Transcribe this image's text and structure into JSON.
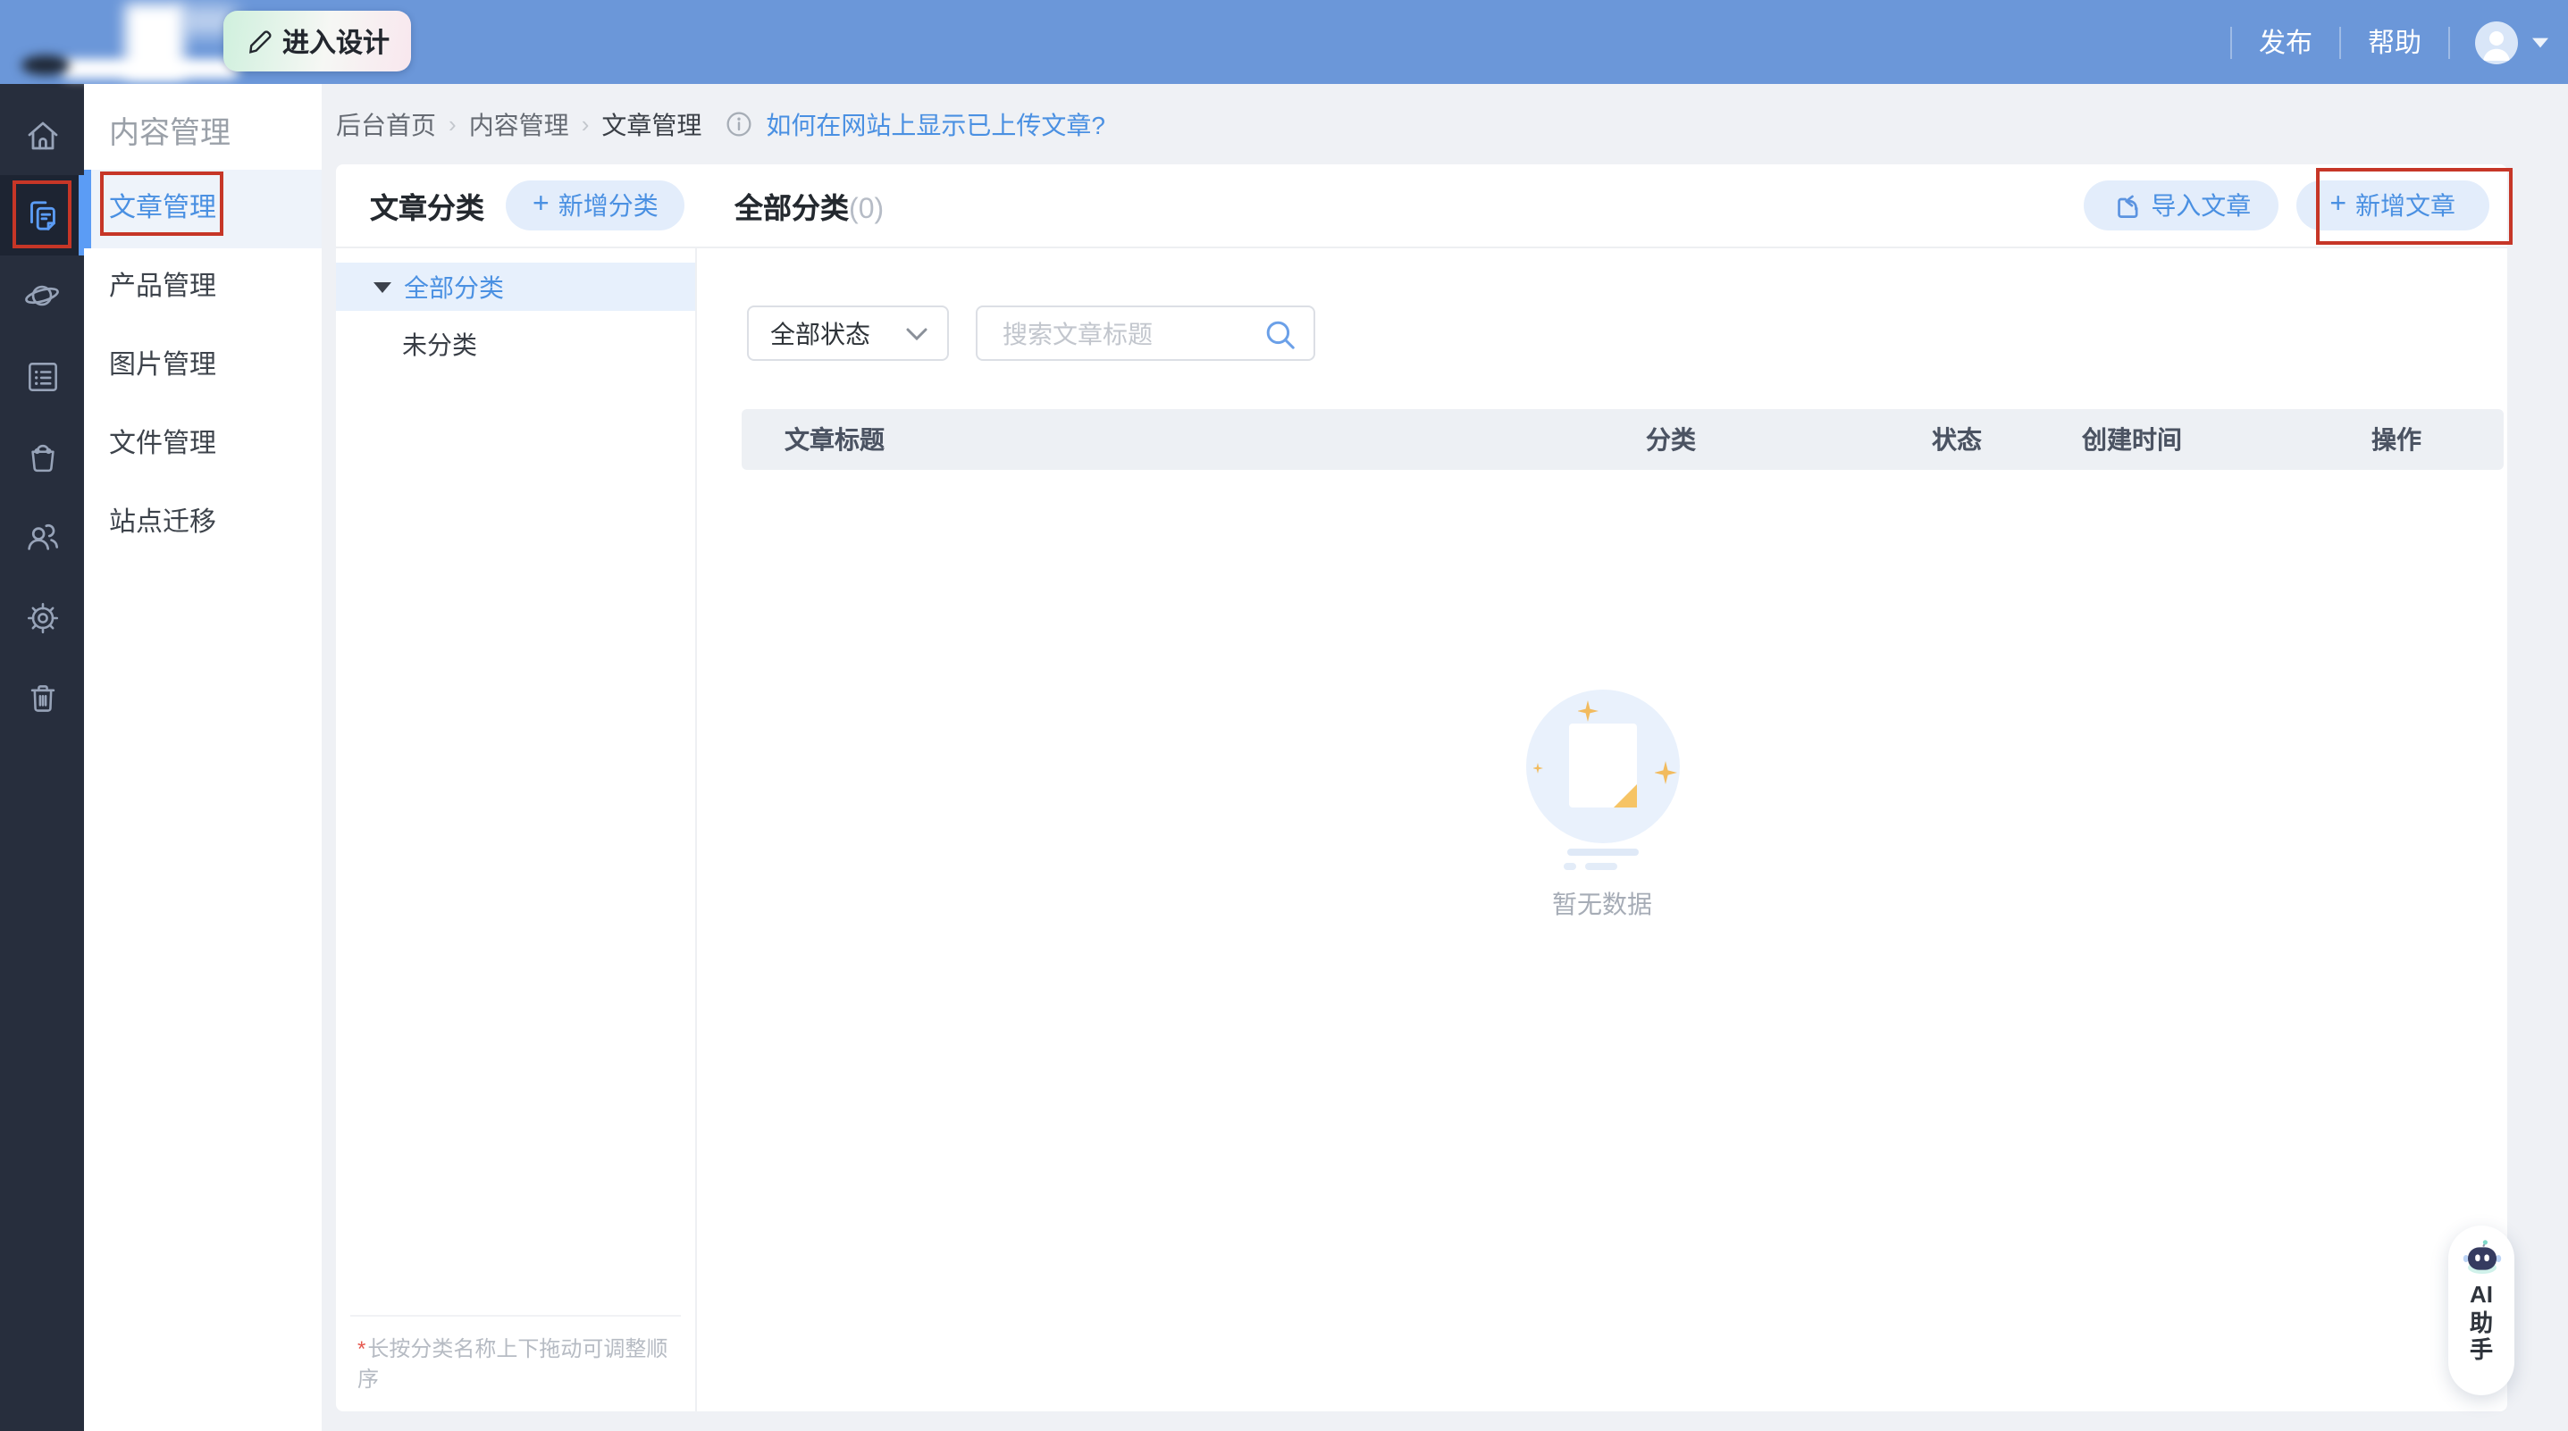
{
  "topbar": {
    "design_button": "进入设计",
    "publish": "发布",
    "help": "帮助"
  },
  "sidebar": {
    "icons": [
      "home",
      "content-pages",
      "site-planet",
      "form-list",
      "mall-bag",
      "members",
      "settings",
      "trash"
    ],
    "active_icon": "content-pages"
  },
  "submenu": {
    "title": "内容管理",
    "items": [
      "文章管理",
      "产品管理",
      "图片管理",
      "文件管理",
      "站点迁移"
    ],
    "active_item": "文章管理"
  },
  "breadcrumb": {
    "items": [
      "后台首页",
      "内容管理",
      "文章管理"
    ],
    "separator": "›",
    "help_link": "如何在网站上显示已上传文章?"
  },
  "category_panel": {
    "title": "文章分类",
    "add_button": "新增分类",
    "tree": [
      "全部分类",
      "未分类"
    ],
    "selected": "全部分类",
    "footer_star": "*",
    "footer_note": "长按分类名称上下拖动可调整顺序"
  },
  "main": {
    "heading": "全部分类",
    "count": "(0)",
    "import_button": "导入文章",
    "add_button": "新增文章",
    "status_filter": "全部状态",
    "search_placeholder": "搜索文章标题",
    "table_headers": [
      "文章标题",
      "分类",
      "状态",
      "创建时间",
      "操作"
    ],
    "empty_text": "暂无数据"
  },
  "ai_assistant": {
    "label": "AI助手",
    "lines": [
      "AI",
      "助",
      "手"
    ]
  },
  "colors": {
    "accent": "#4a90e2",
    "topbar": "#6b97d9",
    "sidebar": "#272e3d",
    "annotation": "#c63627",
    "note_star": "#e5574d",
    "empty_fold": "#f6c465"
  }
}
